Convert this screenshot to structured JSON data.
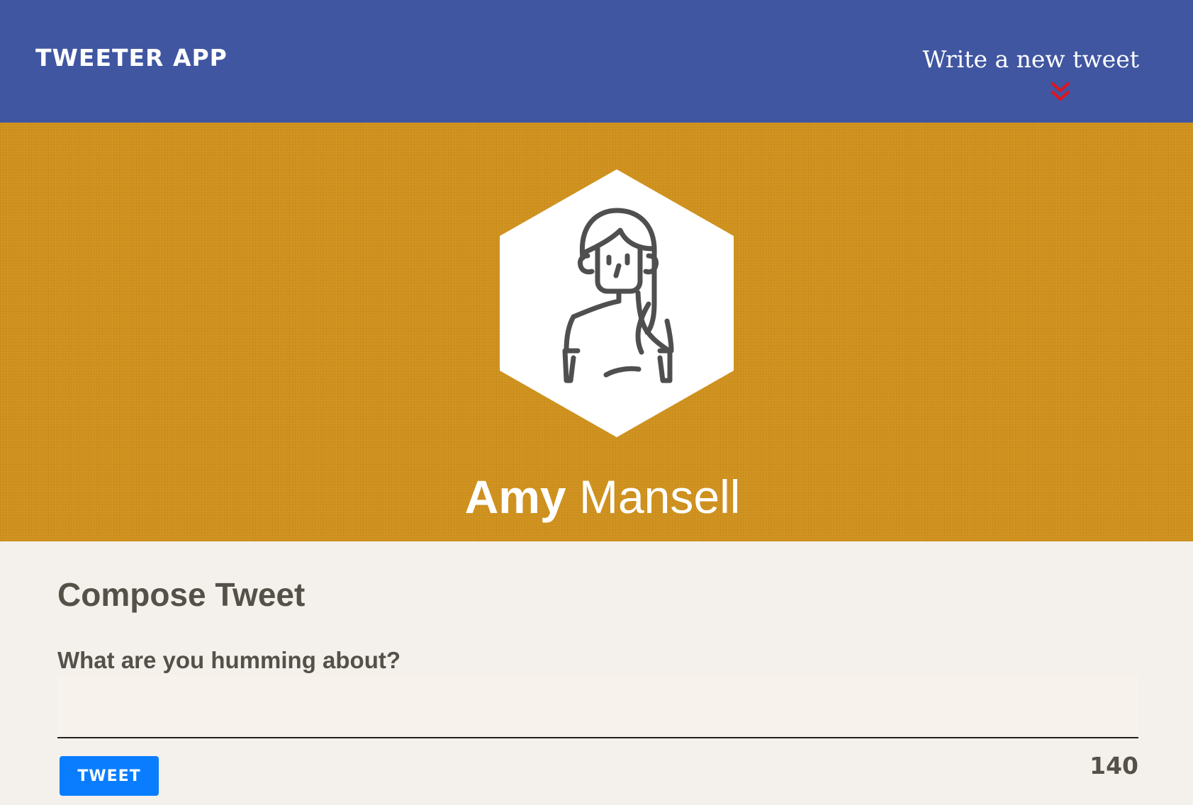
{
  "header": {
    "brand": "TWEETER APP",
    "new_tweet_label": "Write a new tweet",
    "new_tweet_icon": "double-chevron-down-icon",
    "background": "#4056a1",
    "icon_color": "#e0141e"
  },
  "profile": {
    "avatar_icon": "female-user-avatar-icon",
    "first_name": "Amy",
    "last_name": "Mansell",
    "background": "#d29420"
  },
  "compose": {
    "title": "Compose Tweet",
    "label": "What are you humming about?",
    "textarea_value": "",
    "tweet_button_label": "TWEET",
    "counter": "140",
    "button_color": "#0a7dff"
  }
}
